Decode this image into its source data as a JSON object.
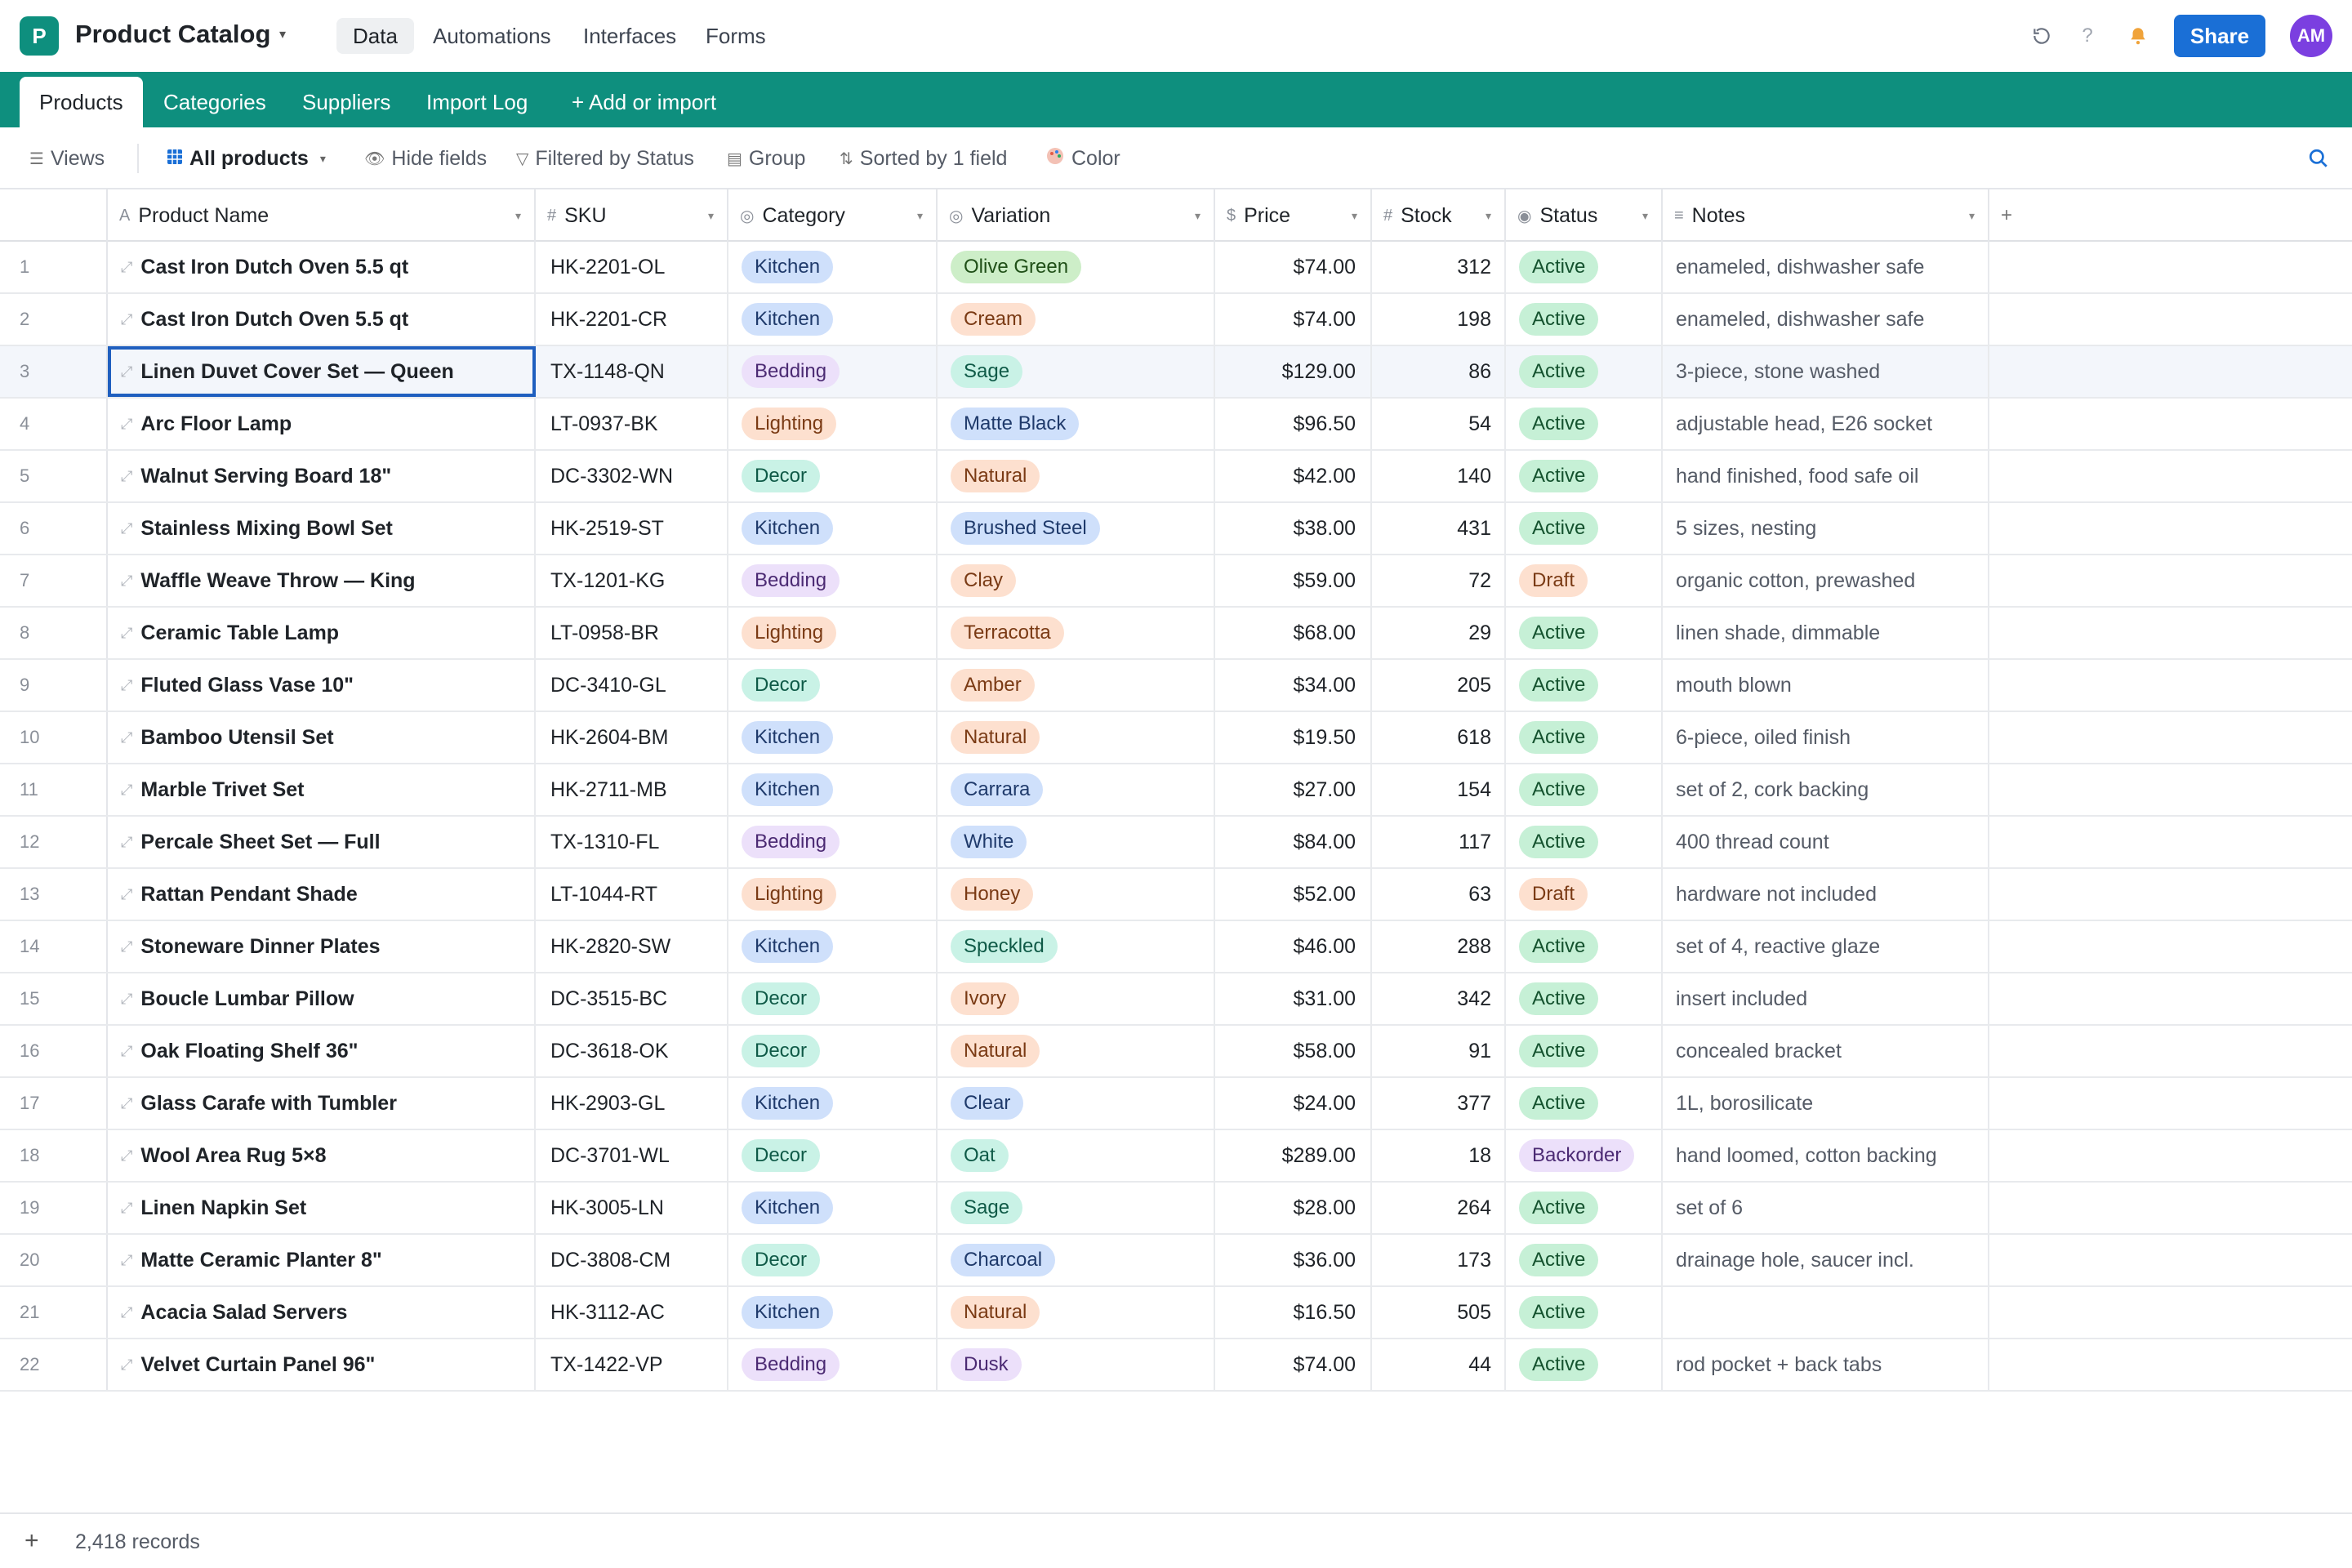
{
  "app": {
    "logo_letter": "P",
    "title": "Product Catalog",
    "nav": [
      "Data",
      "Automations",
      "Interfaces",
      "Forms"
    ],
    "share_label": "Share",
    "avatar_initials": "AM",
    "accent": "#0e8f7e",
    "share_color": "#1a6fd6",
    "avatar_color": "#7b3fe0"
  },
  "tables": [
    "Products",
    "Categories",
    "Suppliers",
    "Import Log",
    "+  Add or import"
  ],
  "toolbar": {
    "views_label": "Views",
    "view_name": "All products",
    "hide_fields": "Hide fields",
    "filter": "Filtered by Status",
    "group": "Group",
    "sort": "Sorted by 1 field",
    "color": "Color"
  },
  "columns": [
    {
      "label": "Product Name",
      "type_icon": "A"
    },
    {
      "label": "SKU",
      "type_icon": "#"
    },
    {
      "label": "Category",
      "type_icon": "◎"
    },
    {
      "label": "Variation",
      "type_icon": "◎"
    },
    {
      "label": "Price",
      "type_icon": "$"
    },
    {
      "label": "Stock",
      "type_icon": "#"
    },
    {
      "label": "Status",
      "type_icon": "◉"
    },
    {
      "label": "Notes",
      "type_icon": "≡"
    }
  ],
  "add_column_label": "+",
  "selected_row": 3,
  "category_colors": {
    "Kitchen": {
      "bg": "#cfe0fb",
      "fg": "#1f3a6b"
    },
    "Bedding": {
      "bg": "#ece0fa",
      "fg": "#4b2a73"
    },
    "Lighting": {
      "bg": "#fde0cf",
      "fg": "#7a3a14"
    },
    "Decor": {
      "bg": "#c9f2e6",
      "fg": "#0f5a47"
    }
  },
  "status_colors": {
    "Active": {
      "bg": "#c6f0d6",
      "fg": "#14522e"
    },
    "Draft": {
      "bg": "#fde0cf",
      "fg": "#7a3a14"
    },
    "Backorder": {
      "bg": "#ece0fa",
      "fg": "#4b2a73"
    }
  },
  "variation_colors": {
    "green": {
      "bg": "#cdeec8",
      "fg": "#1f4f17"
    },
    "orange": {
      "bg": "#fde0cf",
      "fg": "#7a3a14"
    },
    "teal": {
      "bg": "#c9f2e6",
      "fg": "#0f5a47"
    },
    "blue": {
      "bg": "#cfe0fb",
      "fg": "#1f3a6b"
    },
    "purple": {
      "bg": "#ece0fa",
      "fg": "#4b2a73"
    }
  },
  "rows": [
    {
      "n": "1",
      "name": "Cast Iron Dutch Oven 5.5 qt",
      "sku": "HK-2201-OL",
      "category": "Kitchen",
      "variation": "Olive Green",
      "vcolor": "green",
      "price": "$74.00",
      "stock": "312",
      "status": "Active",
      "notes": "enameled, dishwasher safe"
    },
    {
      "n": "2",
      "name": "Cast Iron Dutch Oven 5.5 qt",
      "sku": "HK-2201-CR",
      "category": "Kitchen",
      "variation": "Cream",
      "vcolor": "orange",
      "price": "$74.00",
      "stock": "198",
      "status": "Active",
      "notes": "enameled, dishwasher safe"
    },
    {
      "n": "3",
      "name": "Linen Duvet Cover Set — Queen",
      "sku": "TX-1148-QN",
      "category": "Bedding",
      "variation": "Sage",
      "vcolor": "teal",
      "price": "$129.00",
      "stock": "86",
      "status": "Active",
      "notes": "3-piece, stone washed"
    },
    {
      "n": "4",
      "name": "Arc Floor Lamp",
      "sku": "LT-0937-BK",
      "category": "Lighting",
      "variation": "Matte Black",
      "vcolor": "blue",
      "price": "$96.50",
      "stock": "54",
      "status": "Active",
      "notes": "adjustable head, E26 socket"
    },
    {
      "n": "5",
      "name": "Walnut Serving Board 18\"",
      "sku": "DC-3302-WN",
      "category": "Decor",
      "variation": "Natural",
      "vcolor": "orange",
      "price": "$42.00",
      "stock": "140",
      "status": "Active",
      "notes": "hand finished, food safe oil"
    },
    {
      "n": "6",
      "name": "Stainless Mixing Bowl Set",
      "sku": "HK-2519-ST",
      "category": "Kitchen",
      "variation": "Brushed Steel",
      "vcolor": "blue",
      "price": "$38.00",
      "stock": "431",
      "status": "Active",
      "notes": "5 sizes, nesting"
    },
    {
      "n": "7",
      "name": "Waffle Weave Throw — King",
      "sku": "TX-1201-KG",
      "category": "Bedding",
      "variation": "Clay",
      "vcolor": "orange",
      "price": "$59.00",
      "stock": "72",
      "status": "Draft",
      "notes": "organic cotton, prewashed"
    },
    {
      "n": "8",
      "name": "Ceramic Table Lamp",
      "sku": "LT-0958-BR",
      "category": "Lighting",
      "variation": "Terracotta",
      "vcolor": "orange",
      "price": "$68.00",
      "stock": "29",
      "status": "Active",
      "notes": "linen shade, dimmable"
    },
    {
      "n": "9",
      "name": "Fluted Glass Vase 10\"",
      "sku": "DC-3410-GL",
      "category": "Decor",
      "variation": "Amber",
      "vcolor": "orange",
      "price": "$34.00",
      "stock": "205",
      "status": "Active",
      "notes": "mouth blown"
    },
    {
      "n": "10",
      "name": "Bamboo Utensil Set",
      "sku": "HK-2604-BM",
      "category": "Kitchen",
      "variation": "Natural",
      "vcolor": "orange",
      "price": "$19.50",
      "stock": "618",
      "status": "Active",
      "notes": "6-piece, oiled finish"
    },
    {
      "n": "11",
      "name": "Marble Trivet Set",
      "sku": "HK-2711-MB",
      "category": "Kitchen",
      "variation": "Carrara",
      "vcolor": "blue",
      "price": "$27.00",
      "stock": "154",
      "status": "Active",
      "notes": "set of 2, cork backing"
    },
    {
      "n": "12",
      "name": "Percale Sheet Set — Full",
      "sku": "TX-1310-FL",
      "category": "Bedding",
      "variation": "White",
      "vcolor": "blue",
      "price": "$84.00",
      "stock": "117",
      "status": "Active",
      "notes": "400 thread count"
    },
    {
      "n": "13",
      "name": "Rattan Pendant Shade",
      "sku": "LT-1044-RT",
      "category": "Lighting",
      "variation": "Honey",
      "vcolor": "orange",
      "price": "$52.00",
      "stock": "63",
      "status": "Draft",
      "notes": "hardware not included"
    },
    {
      "n": "14",
      "name": "Stoneware Dinner Plates",
      "sku": "HK-2820-SW",
      "category": "Kitchen",
      "variation": "Speckled",
      "vcolor": "teal",
      "price": "$46.00",
      "stock": "288",
      "status": "Active",
      "notes": "set of 4, reactive glaze"
    },
    {
      "n": "15",
      "name": "Boucle Lumbar Pillow",
      "sku": "DC-3515-BC",
      "category": "Decor",
      "variation": "Ivory",
      "vcolor": "orange",
      "price": "$31.00",
      "stock": "342",
      "status": "Active",
      "notes": "insert included"
    },
    {
      "n": "16",
      "name": "Oak Floating Shelf 36\"",
      "sku": "DC-3618-OK",
      "category": "Decor",
      "variation": "Natural",
      "vcolor": "orange",
      "price": "$58.00",
      "stock": "91",
      "status": "Active",
      "notes": "concealed bracket"
    },
    {
      "n": "17",
      "name": "Glass Carafe with Tumbler",
      "sku": "HK-2903-GL",
      "category": "Kitchen",
      "variation": "Clear",
      "vcolor": "blue",
      "price": "$24.00",
      "stock": "377",
      "status": "Active",
      "notes": "1L, borosilicate"
    },
    {
      "n": "18",
      "name": "Wool Area Rug 5×8",
      "sku": "DC-3701-WL",
      "category": "Decor",
      "variation": "Oat",
      "vcolor": "teal",
      "price": "$289.00",
      "stock": "18",
      "status": "Backorder",
      "notes": "hand loomed, cotton backing"
    },
    {
      "n": "19",
      "name": "Linen Napkin Set",
      "sku": "HK-3005-LN",
      "category": "Kitchen",
      "variation": "Sage",
      "vcolor": "teal",
      "price": "$28.00",
      "stock": "264",
      "status": "Active",
      "notes": "set of 6"
    },
    {
      "n": "20",
      "name": "Matte Ceramic Planter 8\"",
      "sku": "DC-3808-CM",
      "category": "Decor",
      "variation": "Charcoal",
      "vcolor": "blue",
      "price": "$36.00",
      "stock": "173",
      "status": "Active",
      "notes": "drainage hole, saucer incl."
    },
    {
      "n": "21",
      "name": "Acacia Salad Servers",
      "sku": "HK-3112-AC",
      "category": "Kitchen",
      "variation": "Natural",
      "vcolor": "orange",
      "price": "$16.50",
      "stock": "505",
      "status": "Active",
      "notes": ""
    },
    {
      "n": "22",
      "name": "Velvet Curtain Panel 96\"",
      "sku": "TX-1422-VP",
      "category": "Bedding",
      "variation": "Dusk",
      "vcolor": "purple",
      "price": "$74.00",
      "stock": "44",
      "status": "Active",
      "notes": "rod pocket + back tabs"
    }
  ],
  "footer": {
    "add_label": "+",
    "record_count": "2,418 records"
  }
}
